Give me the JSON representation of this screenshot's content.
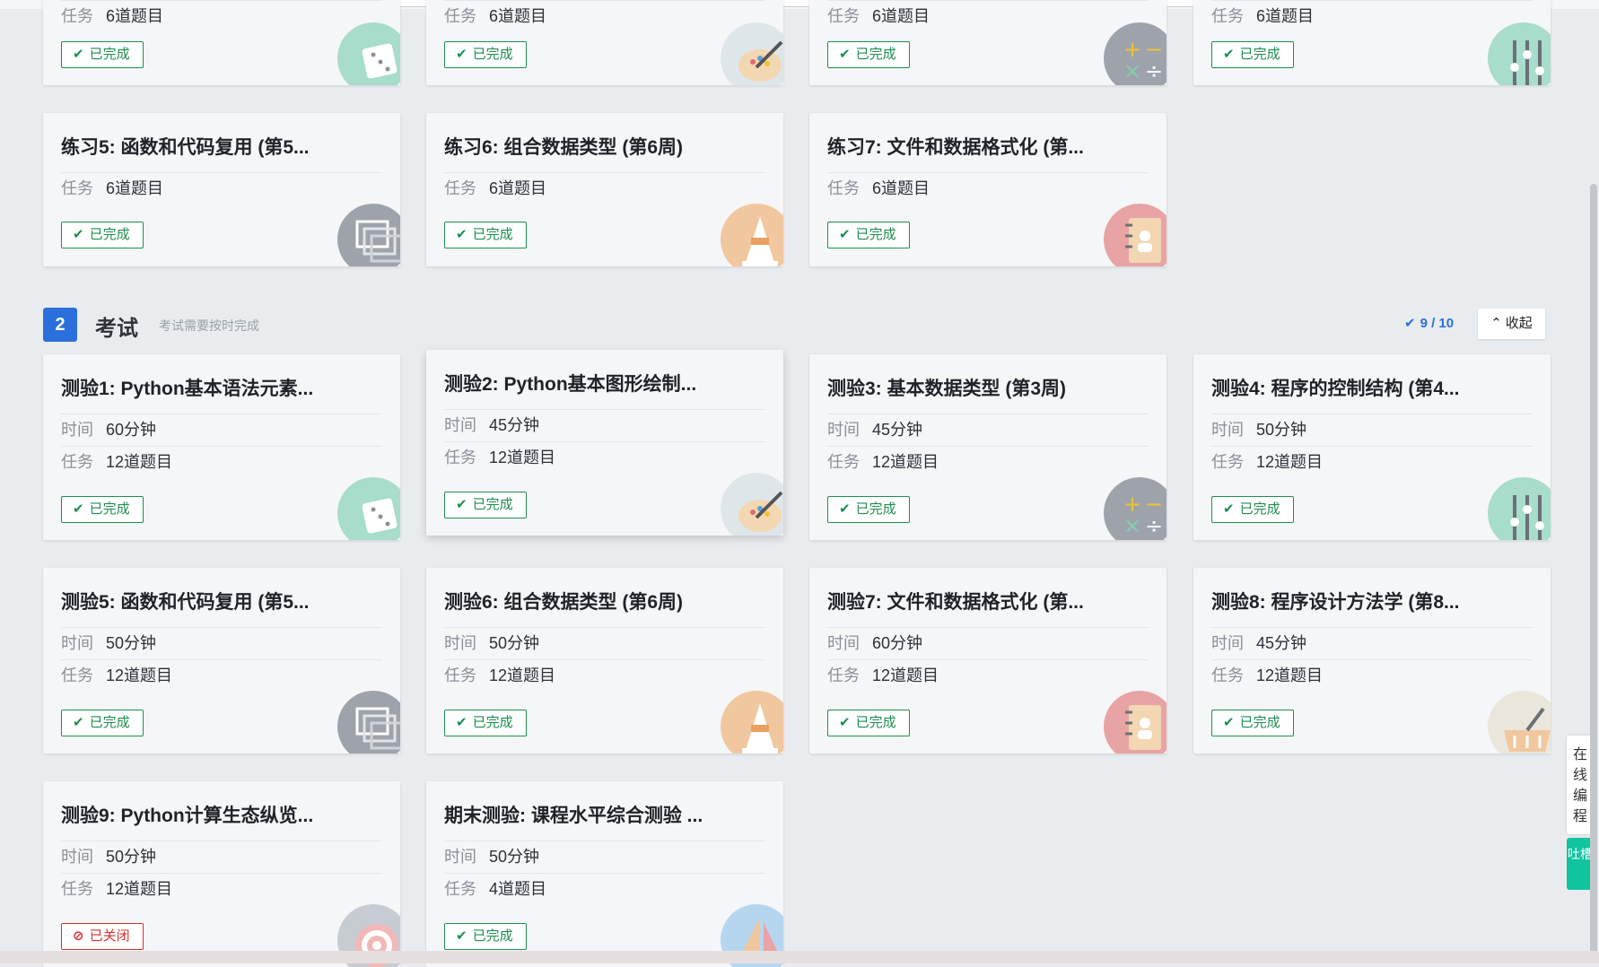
{
  "exercises_top_row": {
    "row_label": "任务",
    "row_value": "6道题目",
    "status": "已完成"
  },
  "exercises": [
    {
      "title": "练习5: 函数和代码复用 (第5...",
      "task_label": "任务",
      "task_value": "6道题目",
      "status": "已完成",
      "icon": "stacked-windows-icon"
    },
    {
      "title": "练习6: 组合数据类型 (第6周)",
      "task_label": "任务",
      "task_value": "6道题目",
      "status": "已完成",
      "icon": "traffic-cone-icon"
    },
    {
      "title": "练习7: 文件和数据格式化 (第...",
      "task_label": "任务",
      "task_value": "6道题目",
      "status": "已完成",
      "icon": "contact-book-icon"
    }
  ],
  "section": {
    "number": "2",
    "title": "考试",
    "description": "考试需要按时完成",
    "progress": "9 / 10",
    "collapse_label": "收起"
  },
  "exams": [
    {
      "title": "测验1: Python基本语法元素...",
      "time_label": "时间",
      "time_value": "60分钟",
      "task_label": "任务",
      "task_value": "12道题目",
      "status": "已完成",
      "icon": "dice-icon"
    },
    {
      "title": "测验2: Python基本图形绘制...",
      "time_label": "时间",
      "time_value": "45分钟",
      "task_label": "任务",
      "task_value": "12道题目",
      "status": "已完成",
      "icon": "paint-palette-icon"
    },
    {
      "title": "测验3: 基本数据类型 (第3周)",
      "time_label": "时间",
      "time_value": "45分钟",
      "task_label": "任务",
      "task_value": "12道题目",
      "status": "已完成",
      "icon": "math-operators-icon"
    },
    {
      "title": "测验4: 程序的控制结构 (第4...",
      "time_label": "时间",
      "time_value": "50分钟",
      "task_label": "任务",
      "task_value": "12道题目",
      "status": "已完成",
      "icon": "sliders-icon"
    },
    {
      "title": "测验5: 函数和代码复用 (第5...",
      "time_label": "时间",
      "time_value": "50分钟",
      "task_label": "任务",
      "task_value": "12道题目",
      "status": "已完成",
      "icon": "stacked-windows-icon"
    },
    {
      "title": "测验6: 组合数据类型 (第6周)",
      "time_label": "时间",
      "time_value": "50分钟",
      "task_label": "任务",
      "task_value": "12道题目",
      "status": "已完成",
      "icon": "traffic-cone-icon"
    },
    {
      "title": "测验7: 文件和数据格式化 (第...",
      "time_label": "时间",
      "time_value": "60分钟",
      "task_label": "任务",
      "task_value": "12道题目",
      "status": "已完成",
      "icon": "contact-book-icon"
    },
    {
      "title": "测验8: 程序设计方法学 (第8...",
      "time_label": "时间",
      "time_value": "45分钟",
      "task_label": "任务",
      "task_value": "12道题目",
      "status": "已完成",
      "icon": "basket-icon"
    },
    {
      "title": "测验9: Python计算生态纵览...",
      "time_label": "时间",
      "time_value": "50分钟",
      "task_label": "任务",
      "task_value": "12道题目",
      "status": "已关闭",
      "icon": "target-icon"
    },
    {
      "title": "期末测验: 课程水平综合测验 ...",
      "time_label": "时间",
      "time_value": "50分钟",
      "task_label": "任务",
      "task_value": "4道题目",
      "status": "已完成",
      "icon": "sailboat-icon"
    }
  ],
  "side_tabs": {
    "online_coding": "在线编程",
    "feedback": "吐槽"
  },
  "colors": {
    "accent_blue": "#2b6fdc",
    "done_green": "#1e8e4e",
    "closed_red": "#d92e2e",
    "feedback_teal": "#10c4a0"
  }
}
